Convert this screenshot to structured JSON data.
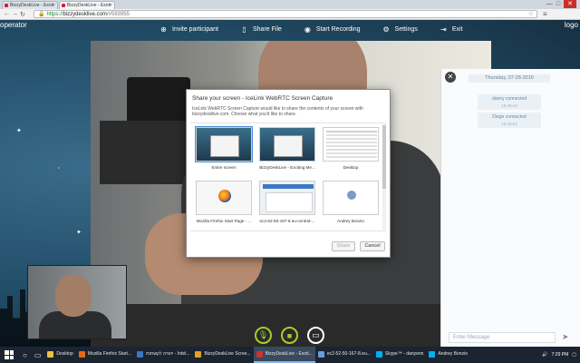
{
  "browser": {
    "tabs": [
      {
        "title": "BizzyDeskLive - Exoti",
        "active": false
      },
      {
        "title": "BizzyDeskLive - Exoti",
        "active": true
      }
    ],
    "url_secure": "https://",
    "url_host": "bizzydesklive.com",
    "url_path": "/#593955"
  },
  "app": {
    "operator_label": "operator",
    "logo_label": "logo",
    "toolbar": [
      {
        "label": "Invite participant",
        "icon": "plus-circle-icon"
      },
      {
        "label": "Share File",
        "icon": "file-icon"
      },
      {
        "label": "Start Recording",
        "icon": "record-icon"
      },
      {
        "label": "Settings",
        "icon": "gear-icon"
      },
      {
        "label": "Exit",
        "icon": "exit-icon"
      }
    ]
  },
  "chat": {
    "date": "Thursday, 07-28-2016",
    "messages": [
      {
        "text": "danny connected",
        "time": "15:25:43"
      },
      {
        "text": "Diego connected",
        "time": "15:25:54"
      }
    ],
    "input_placeholder": "Enter Message"
  },
  "dialog": {
    "title": "Share your screen - IceLink WebRTC Screen Capture",
    "description": "IceLink WebRTC Screen Capture would like to share the contents of your screen with bizzydesklive.com. Choose what you'd like to share.",
    "thumbnails": [
      {
        "label": "Entire screen",
        "kind": "screen"
      },
      {
        "label": "BizzyDeskLive - Exciting Me...",
        "kind": "screen"
      },
      {
        "label": "Desktop",
        "kind": "desk"
      },
      {
        "label": "Mozilla Firefox Start Page - ...",
        "kind": "ff"
      },
      {
        "label": "ec2-52-50-167-8.eu-central-...",
        "kind": "ec2"
      },
      {
        "label": "Andrey Bonzio",
        "kind": "skype"
      }
    ],
    "share_label": "Share",
    "cancel_label": "Cancel"
  },
  "taskbar": {
    "items": [
      {
        "label": "Desktop",
        "color": "#f0c040"
      },
      {
        "label": "Mozilla Firefox Start...",
        "color": "#e66a12"
      },
      {
        "label": "יהודה לקשתות - Intel...",
        "color": "#3a78c3"
      },
      {
        "label": "BizzyDeskLive Scree...",
        "color": "#e0a020"
      },
      {
        "label": "BizzyDeskLive - Exoti...",
        "color": "#d03030"
      },
      {
        "label": "ec2-52-50-167-8.eu...",
        "color": "#6a9bd8"
      },
      {
        "label": "Skype™ - danyenn",
        "color": "#00aff0"
      },
      {
        "label": "Andrey Bonzio",
        "color": "#00aff0"
      }
    ],
    "time": "7:29 PM"
  }
}
